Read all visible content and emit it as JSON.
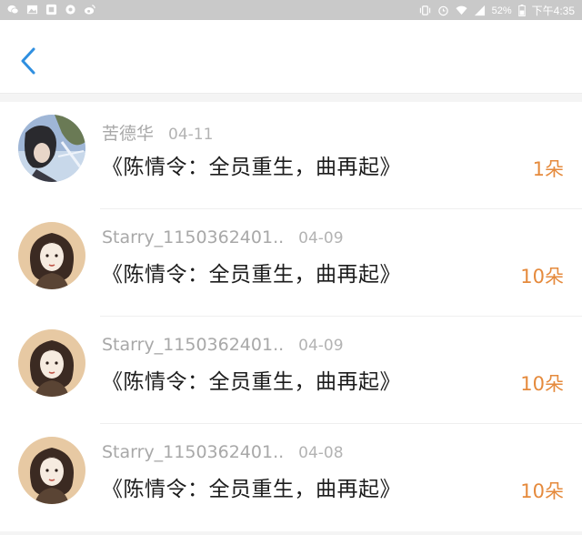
{
  "status_bar": {
    "battery": "52%",
    "time": "下午4:35",
    "left_icons": [
      "wechat-icon",
      "image-icon",
      "app-icon",
      "circle-icon",
      "weibo-icon"
    ],
    "right_icons": [
      "vibrate-icon",
      "alarm-icon",
      "wifi-icon",
      "signal-icon"
    ]
  },
  "header": {
    "back_icon": "chevron-left-icon",
    "accent_color": "#2f8fe0"
  },
  "gifts": [
    {
      "user": "苦德华",
      "date": "04-11",
      "title": "《陈情令：全员重生，曲再起》",
      "count": "1朵"
    },
    {
      "user": "Starry_1150362401..",
      "date": "04-09",
      "title": "《陈情令：全员重生，曲再起》",
      "count": "10朵"
    },
    {
      "user": "Starry_1150362401..",
      "date": "04-09",
      "title": "《陈情令：全员重生，曲再起》",
      "count": "10朵"
    },
    {
      "user": "Starry_1150362401..",
      "date": "04-08",
      "title": "《陈情令：全员重生，曲再起》",
      "count": "10朵"
    }
  ],
  "colors": {
    "count": "#e58a3c",
    "username": "#a8a8a8",
    "title": "#1c1c1c"
  }
}
